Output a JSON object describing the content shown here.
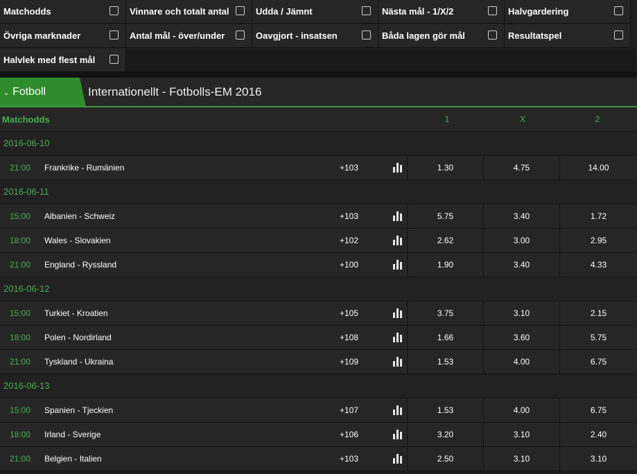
{
  "filters": [
    [
      {
        "label": "Matchodds"
      },
      {
        "label": "Vinnare och totalt antal"
      },
      {
        "label": "Udda / Jämnt"
      },
      {
        "label": "Nästa mål - 1/X/2"
      },
      {
        "label": "Halvgardering"
      }
    ],
    [
      {
        "label": "Övriga marknader"
      },
      {
        "label": "Antal mål - över/under"
      },
      {
        "label": "Oavgjort - insatsen"
      },
      {
        "label": "Båda lagen gör mål"
      },
      {
        "label": "Resultatspel"
      }
    ],
    [
      {
        "label": "Halvlek med flest mål"
      }
    ]
  ],
  "sport": {
    "label": "Fotboll"
  },
  "league": {
    "title": "Internationellt - Fotbolls-EM 2016"
  },
  "market": {
    "label": "Matchodds",
    "col1": "1",
    "colx": "X",
    "col2": "2"
  },
  "days": [
    {
      "date": "2016-06-10",
      "matches": [
        {
          "time": "21:00",
          "teams": "Frankrike - Rumänien",
          "more": "+103",
          "o1": "1.30",
          "ox": "4.75",
          "o2": "14.00"
        }
      ]
    },
    {
      "date": "2016-06-11",
      "matches": [
        {
          "time": "15:00",
          "teams": "Albanien - Schweiz",
          "more": "+103",
          "o1": "5.75",
          "ox": "3.40",
          "o2": "1.72"
        },
        {
          "time": "18:00",
          "teams": "Wales - Slovakien",
          "more": "+102",
          "o1": "2.62",
          "ox": "3.00",
          "o2": "2.95"
        },
        {
          "time": "21:00",
          "teams": "England - Ryssland",
          "more": "+100",
          "o1": "1.90",
          "ox": "3.40",
          "o2": "4.33"
        }
      ]
    },
    {
      "date": "2016-06-12",
      "matches": [
        {
          "time": "15:00",
          "teams": "Turkiet - Kroatien",
          "more": "+105",
          "o1": "3.75",
          "ox": "3.10",
          "o2": "2.15"
        },
        {
          "time": "18:00",
          "teams": "Polen - Nordirland",
          "more": "+108",
          "o1": "1.66",
          "ox": "3.60",
          "o2": "5.75"
        },
        {
          "time": "21:00",
          "teams": "Tyskland - Ukraina",
          "more": "+109",
          "o1": "1.53",
          "ox": "4.00",
          "o2": "6.75"
        }
      ]
    },
    {
      "date": "2016-06-13",
      "matches": [
        {
          "time": "15:00",
          "teams": "Spanien - Tjeckien",
          "more": "+107",
          "o1": "1.53",
          "ox": "4.00",
          "o2": "6.75"
        },
        {
          "time": "18:00",
          "teams": "Irland - Sverige",
          "more": "+106",
          "o1": "3.20",
          "ox": "3.10",
          "o2": "2.40"
        },
        {
          "time": "21:00",
          "teams": "Belgien - Italien",
          "more": "+103",
          "o1": "2.50",
          "ox": "3.10",
          "o2": "3.10"
        }
      ]
    }
  ],
  "colors": {
    "accent": "#4caf50",
    "tab": "#2e8b2e",
    "background": "#1e1e1e"
  }
}
